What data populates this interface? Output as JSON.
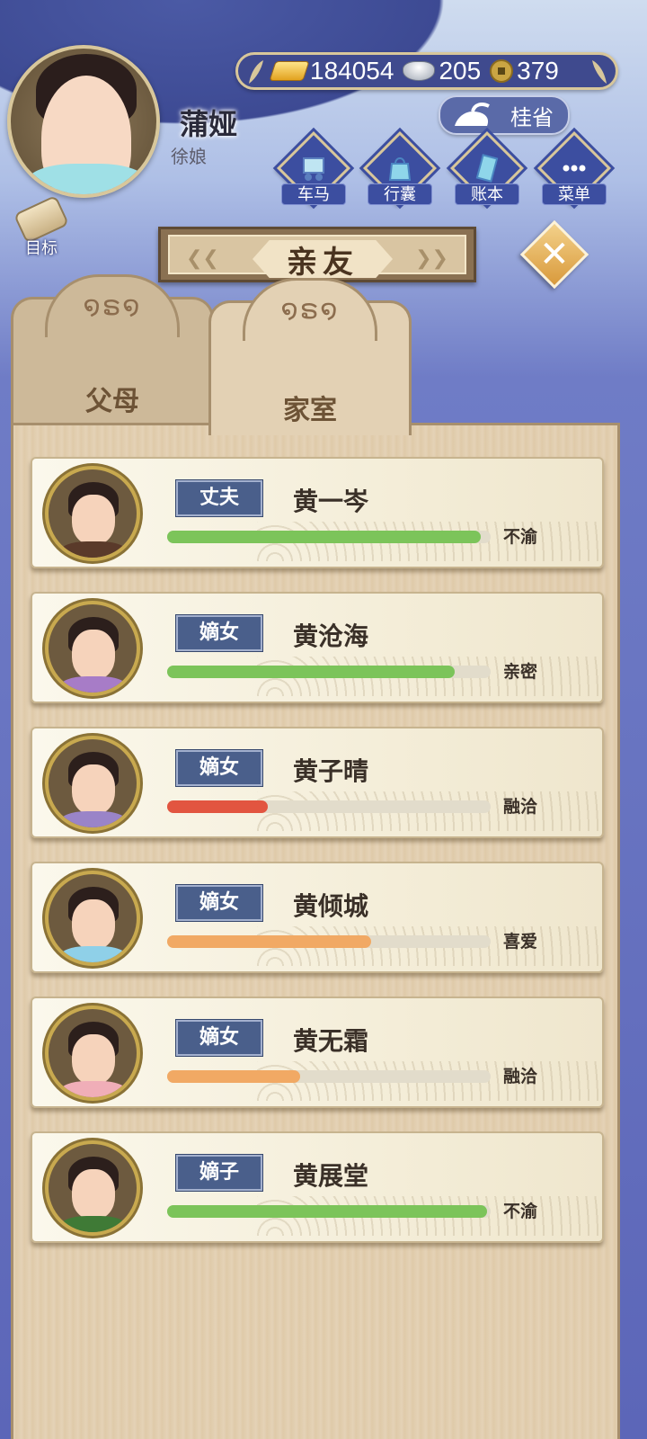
{
  "player": {
    "name": "蒲娅",
    "title": "徐娘"
  },
  "currency": {
    "gold": "184054",
    "silver": "205",
    "copper": "379"
  },
  "location": {
    "label": "桂省"
  },
  "menu": [
    {
      "label": "车马",
      "icon": "carriage-icon"
    },
    {
      "label": "行囊",
      "icon": "bag-icon"
    },
    {
      "label": "账本",
      "icon": "ledger-icon"
    },
    {
      "label": "菜单",
      "icon": "more-icon"
    }
  ],
  "goal": {
    "label": "目标"
  },
  "page": {
    "title": "亲友"
  },
  "tabs": [
    {
      "label": "父母",
      "active": false
    },
    {
      "label": "家室",
      "active": true
    }
  ],
  "members": [
    {
      "role": "丈夫",
      "name": "黄一岑",
      "status": "不渝",
      "progress": 0.97,
      "bar_color": "#7cc45a",
      "outfit": "#5a3a2a"
    },
    {
      "role": "嫡女",
      "name": "黄沧海",
      "status": "亲密",
      "progress": 0.89,
      "bar_color": "#7cc45a",
      "outfit": "#a77cc7"
    },
    {
      "role": "嫡女",
      "name": "黄子晴",
      "status": "融洽",
      "progress": 0.31,
      "bar_color": "#e25540",
      "outfit": "#9a84c8"
    },
    {
      "role": "嫡女",
      "name": "黄倾城",
      "status": "喜爱",
      "progress": 0.63,
      "bar_color": "#f1a964",
      "outfit": "#8fd0e8"
    },
    {
      "role": "嫡女",
      "name": "黄无霜",
      "status": "融洽",
      "progress": 0.41,
      "bar_color": "#f1a964",
      "outfit": "#f0aeb8"
    },
    {
      "role": "嫡子",
      "name": "黄展堂",
      "status": "不渝",
      "progress": 0.99,
      "bar_color": "#7cc45a",
      "outfit": "#3f7a36"
    }
  ]
}
